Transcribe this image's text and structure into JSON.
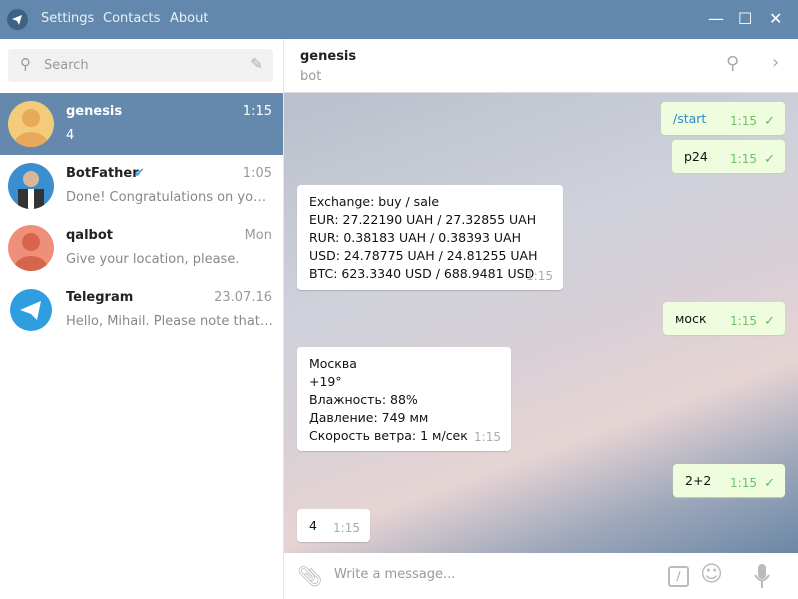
{
  "menu": {
    "settings": "Settings",
    "contacts": "Contacts",
    "about": "About"
  },
  "search": {
    "placeholder": "Search"
  },
  "dialogs": [
    {
      "name": "genesis",
      "time": "1:15",
      "message": "4"
    },
    {
      "name": "BotFather",
      "time": "1:05",
      "message": "Done! Congratulations on your new bot..."
    },
    {
      "name": "qalbot",
      "time": "Mon",
      "message": "Give your location, please."
    },
    {
      "name": "Telegram",
      "time": "23.07.16",
      "message": "Hello, Mihail. Please note that your account..."
    }
  ],
  "header": {
    "title": "genesis",
    "status": "bot"
  },
  "messages": [
    {
      "text": "/start",
      "time": "1:15"
    },
    {
      "text": "p24",
      "time": "1:15"
    },
    {
      "lines": [
        "Exchange: buy / sale",
        "EUR: 27.22190 UAH / 27.32855 UAH",
        "RUR: 0.38183 UAH / 0.38393 UAH",
        "USD: 24.78775 UAH / 24.81255 UAH",
        "BTC: 623.3340 USD / 688.9481 USD"
      ],
      "time": "1:15"
    },
    {
      "text": "моск",
      "time": "1:15"
    },
    {
      "lines": [
        "Москва",
        "+19°",
        "Влажность: 88%",
        "Давление: 749 мм",
        "Скорость ветра: 1 м/сек"
      ],
      "time": "1:15"
    },
    {
      "text": "2+2",
      "time": "1:15"
    },
    {
      "text": "4",
      "time": "1:15"
    }
  ],
  "composer": {
    "placeholder": "Write a message..."
  },
  "colors": {
    "titlebar": "#6289ad",
    "active_dialog": "#6489ad",
    "outgoing_bubble": "#effdde",
    "check": "#5cbf54"
  }
}
